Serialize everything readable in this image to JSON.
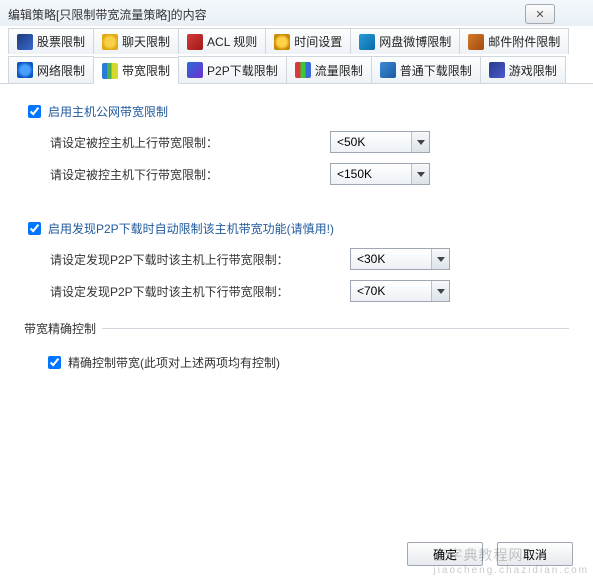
{
  "window": {
    "title": "编辑策略[只限制带宽流量策略]的内容",
    "close_symbol": "✕"
  },
  "tabs": {
    "row1": [
      {
        "label": "股票限制"
      },
      {
        "label": "聊天限制"
      },
      {
        "label": "ACL 规则"
      },
      {
        "label": "时间设置"
      },
      {
        "label": "网盘微博限制"
      },
      {
        "label": "邮件附件限制"
      }
    ],
    "row2": [
      {
        "label": "网络限制"
      },
      {
        "label": "带宽限制"
      },
      {
        "label": "P2P下载限制"
      },
      {
        "label": "流量限制"
      },
      {
        "label": "普通下载限制"
      },
      {
        "label": "游戏限制"
      }
    ],
    "active_label": "带宽限制"
  },
  "section1": {
    "checkbox_label": "启用主机公网带宽限制",
    "checkbox_checked": true,
    "up_label": "请设定被控主机上行带宽限制：",
    "up_value": "<50K",
    "down_label": "请设定被控主机下行带宽限制：",
    "down_value": "<150K"
  },
  "section2": {
    "checkbox_label": "启用发现P2P下载时自动限制该主机带宽功能(请慎用!)",
    "checkbox_checked": true,
    "up_label": "请设定发现P2P下载时该主机上行带宽限制：",
    "up_value": "<30K",
    "down_label": "请设定发现P2P下载时该主机下行带宽限制：",
    "down_value": "<70K"
  },
  "section3": {
    "legend": "带宽精确控制",
    "checkbox_label": "精确控制带宽(此项对上述两项均有控制)",
    "checkbox_checked": true
  },
  "buttons": {
    "ok": "确定",
    "cancel": "取消"
  },
  "watermark": {
    "line1": "查字典教程网",
    "line2": "jiaocheng.chazidian.com"
  }
}
